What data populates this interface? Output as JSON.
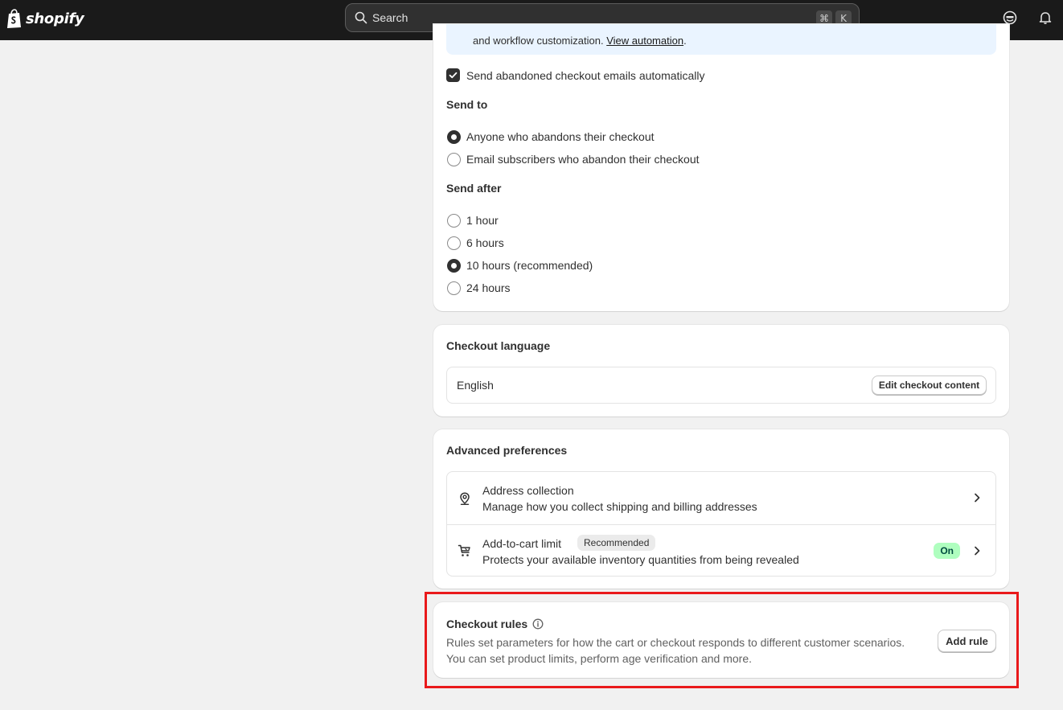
{
  "topbar": {
    "logo_text": "shopify",
    "search_placeholder": "Search",
    "shortcut_cmd": "⌘",
    "shortcut_key": "K"
  },
  "abandoned": {
    "banner_text": "and workflow customization.",
    "banner_link": "View automation",
    "banner_end": ".",
    "auto_send_label": "Send abandoned checkout emails automatically",
    "auto_send_checked": true,
    "send_to_heading": "Send to",
    "send_to_options": [
      {
        "label": "Anyone who abandons their checkout",
        "selected": true
      },
      {
        "label": "Email subscribers who abandon their checkout",
        "selected": false
      }
    ],
    "send_after_heading": "Send after",
    "send_after_options": [
      {
        "label": "1 hour",
        "selected": false
      },
      {
        "label": "6 hours",
        "selected": false
      },
      {
        "label": "10 hours (recommended)",
        "selected": true
      },
      {
        "label": "24 hours",
        "selected": false
      }
    ]
  },
  "language": {
    "title": "Checkout language",
    "value": "English",
    "edit_button": "Edit checkout content"
  },
  "advanced": {
    "title": "Advanced preferences",
    "address": {
      "title": "Address collection",
      "description": "Manage how you collect shipping and billing addresses"
    },
    "cart_limit": {
      "title": "Add-to-cart limit",
      "badge": "Recommended",
      "description": "Protects your available inventory quantities from being revealed",
      "status": "On"
    }
  },
  "rules": {
    "title": "Checkout rules",
    "description_line1": "Rules set parameters for how the cart or checkout responds to different customer scenarios.",
    "description_line2": "You can set product limits, perform age verification and more.",
    "add_button": "Add rule"
  },
  "colors": {
    "topbar": "#1a1a1a",
    "highlight": "#e9191b",
    "on_badge": "#affebf"
  }
}
